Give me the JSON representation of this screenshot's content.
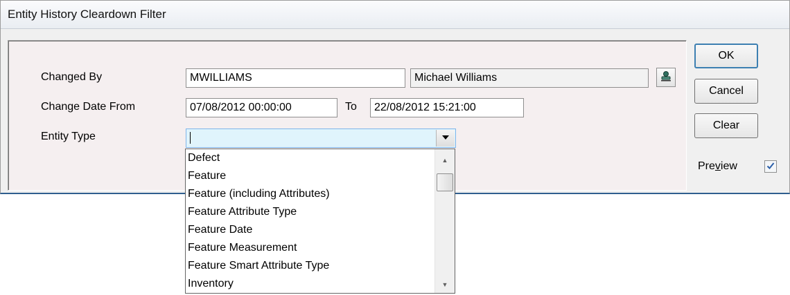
{
  "window": {
    "title": "Entity History Cleardown Filter"
  },
  "form": {
    "changed_by_label": "Changed By",
    "changed_by_code": "MWILLIAMS",
    "changed_by_name": "Michael Williams",
    "change_date_from_label": "Change Date From",
    "date_from": "07/08/2012 00:00:00",
    "to_label": "To",
    "date_to": "22/08/2012 15:21:00",
    "entity_type_label": "Entity Type",
    "entity_type_value": ""
  },
  "dropdown": {
    "items": [
      "Defect",
      "Feature",
      "Feature (including Attributes)",
      "Feature Attribute Type",
      "Feature Date",
      "Feature Measurement",
      "Feature Smart Attribute Type",
      "Inventory"
    ]
  },
  "buttons": {
    "ok": "OK",
    "cancel": "Cancel",
    "clear": "Clear"
  },
  "preview": {
    "label_pre": "Pre",
    "label_accel": "v",
    "label_post": "iew",
    "checked": true
  },
  "icons": {
    "lookup": "lookup-icon",
    "dropdown_arrow": "chevron-down-icon",
    "scroll_up": "scroll-up-icon",
    "scroll_down": "scroll-down-icon",
    "check": "check-icon"
  }
}
